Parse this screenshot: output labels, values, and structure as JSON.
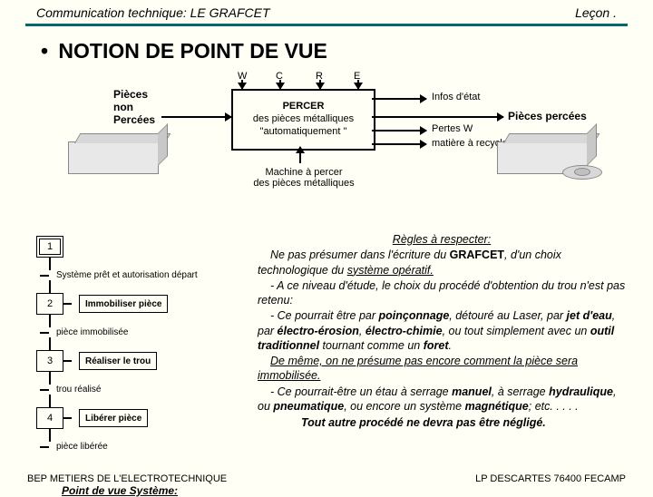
{
  "header": {
    "left": "Communication technique: LE GRAFCET",
    "right": "Leçon ."
  },
  "title": "NOTION DE POINT DE VUE",
  "diagram": {
    "inputs": {
      "w": "W",
      "c": "C",
      "r": "R",
      "e": "E"
    },
    "left_label_l1": "Pièces",
    "left_label_l2": "non",
    "left_label_l3": "Percées",
    "main_l1": "PERCER",
    "main_l2": "des pièces métalliques",
    "main_l3": "\"automatiquement \"",
    "out1": "Infos d'état",
    "out2": "Pertes W",
    "out3": "matière à recycler",
    "right_label": "Pièces percées",
    "bottom": "Machine à percer",
    "bottom2": "des pièces métalliques"
  },
  "grafcet": {
    "s1": "1",
    "s2": "2",
    "s3": "3",
    "s4": "4",
    "t1": "Système prêt et autorisation départ",
    "a2": "Immobiliser pièce",
    "t2": "pièce immobilisée",
    "a3": "Réaliser le trou",
    "t3": "trou réalisé",
    "a4": "Libérer pièce",
    "t4": "pièce libérée",
    "caption": "Point de vue Système:"
  },
  "rules": {
    "hd": "Règles à respecter:",
    "p1a": "Ne pas présumer dans l'écriture du ",
    "p1b": "GRAFCET",
    "p1c": ",  d'un choix technologique du ",
    "p1d": "système opératif.",
    "p2": "- A ce niveau d'étude, le choix du procédé d'obtention du trou n'est pas retenu:",
    "p3a": "- Ce pourrait être par ",
    "p3b": "poinçonnage",
    "p3c": ", détouré au Laser, par ",
    "p3d": "jet d'eau",
    "p3e": ", par ",
    "p3f": "électro-érosion",
    "p3g": ", ",
    "p3h": "électro-chimie",
    "p3i": ", ou tout simplement avec un ",
    "p3j": "outil traditionnel",
    "p3k": " tournant comme un ",
    "p3l": "foret",
    "p3m": ".",
    "p4": "De même, on ne présume pas encore comment la pièce sera immobilisée.",
    "p5a": "- Ce pourrait-être un étau à serrage ",
    "p5b": "manuel",
    "p5c": ", à serrage ",
    "p5d": "hydraulique",
    "p5e": ", ou ",
    "p5f": "pneumatique",
    "p5g": ", ou encore un système ",
    "p5h": "magnétique",
    "p5i": ";  etc. . . . .",
    "last": "Tout autre procédé ne devra pas être négligé."
  },
  "footer": {
    "left": "BEP METIERS DE L'ELECTROTECHNIQUE",
    "right": "LP DESCARTES 76400 FECAMP"
  }
}
